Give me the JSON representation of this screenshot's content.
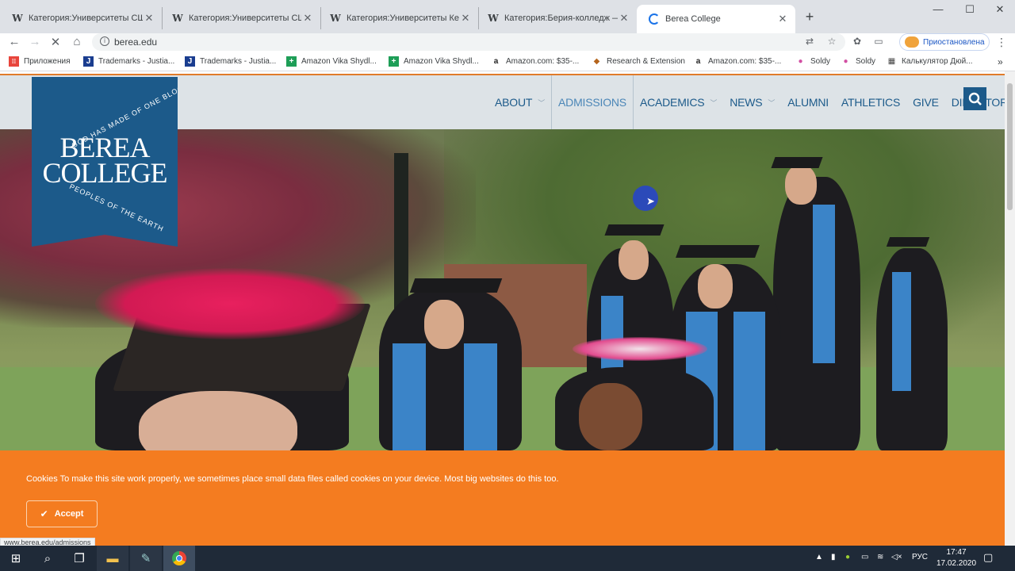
{
  "browser": {
    "tabs": [
      {
        "favicon": "W",
        "title": "Категория:Университеты США –"
      },
      {
        "favicon": "W",
        "title": "Категория:Университеты США |"
      },
      {
        "favicon": "W",
        "title": "Категория:Университеты Кентук"
      },
      {
        "favicon": "W",
        "title": "Категория:Берия-колледж — Ви"
      },
      {
        "favicon": "loading",
        "title": "Berea College"
      }
    ],
    "new_tab": "+",
    "window_controls": {
      "minimize": "—",
      "maximize": "☐",
      "close": "✕"
    },
    "address": "berea.edu",
    "profile_status": "Приостановлена",
    "bookmarks": [
      {
        "icon": "apps",
        "color": "#e8453c",
        "label": "Приложения"
      },
      {
        "icon": "J",
        "color": "#1a3d8f",
        "label": "Trademarks - Justia..."
      },
      {
        "icon": "J",
        "color": "#1a3d8f",
        "label": "Trademarks - Justia..."
      },
      {
        "icon": "+",
        "color": "#1e9e57",
        "label": "Amazon Vika Shydl..."
      },
      {
        "icon": "+",
        "color": "#1e9e57",
        "label": "Amazon Vika Shydl..."
      },
      {
        "icon": "a",
        "color": "#222222",
        "label": "Amazon.com: $35-..."
      },
      {
        "icon": "◆",
        "color": "#b5651d",
        "label": "Research & Extension"
      },
      {
        "icon": "a",
        "color": "#222222",
        "label": "Amazon.com: $35-..."
      },
      {
        "icon": "●",
        "color": "#d24fa3",
        "label": "Soldy"
      },
      {
        "icon": "●",
        "color": "#d24fa3",
        "label": "Soldy"
      },
      {
        "icon": "▦",
        "color": "#444444",
        "label": "Калькулятор Дюй..."
      }
    ],
    "bookmarks_more": "»",
    "status_url": "www.berea.edu/admissions"
  },
  "site": {
    "logo": {
      "line1": "BEREA",
      "line2": "COLLEGE",
      "motto_top": "GOD HAS MADE OF ONE BLOOD ALL",
      "motto_bottom": "PEOPLES OF THE EARTH"
    },
    "nav": [
      {
        "label": "ABOUT",
        "has_menu": true
      },
      {
        "label": "ADMISSIONS",
        "has_menu": false,
        "active": true
      },
      {
        "label": "ACADEMICS",
        "has_menu": true
      },
      {
        "label": "NEWS",
        "has_menu": true
      },
      {
        "label": "ALUMNI",
        "has_menu": false
      },
      {
        "label": "ATHLETICS",
        "has_menu": false
      },
      {
        "label": "GIVE",
        "has_menu": false
      },
      {
        "label": "DIRECTORY",
        "has_menu": false
      }
    ],
    "search_icon": "search-icon",
    "cookie": {
      "message": "Cookies To make this site work properly, we sometimes place small data files called cookies on your device. Most big websites do this too.",
      "accept": "Accept"
    },
    "colors": {
      "brand_blue": "#1c5a8a",
      "cookie_orange": "#f47c20",
      "header_bg": "#dde3e7"
    }
  },
  "taskbar": {
    "language": "РУС",
    "time": "17:47",
    "date": "17.02.2020"
  }
}
